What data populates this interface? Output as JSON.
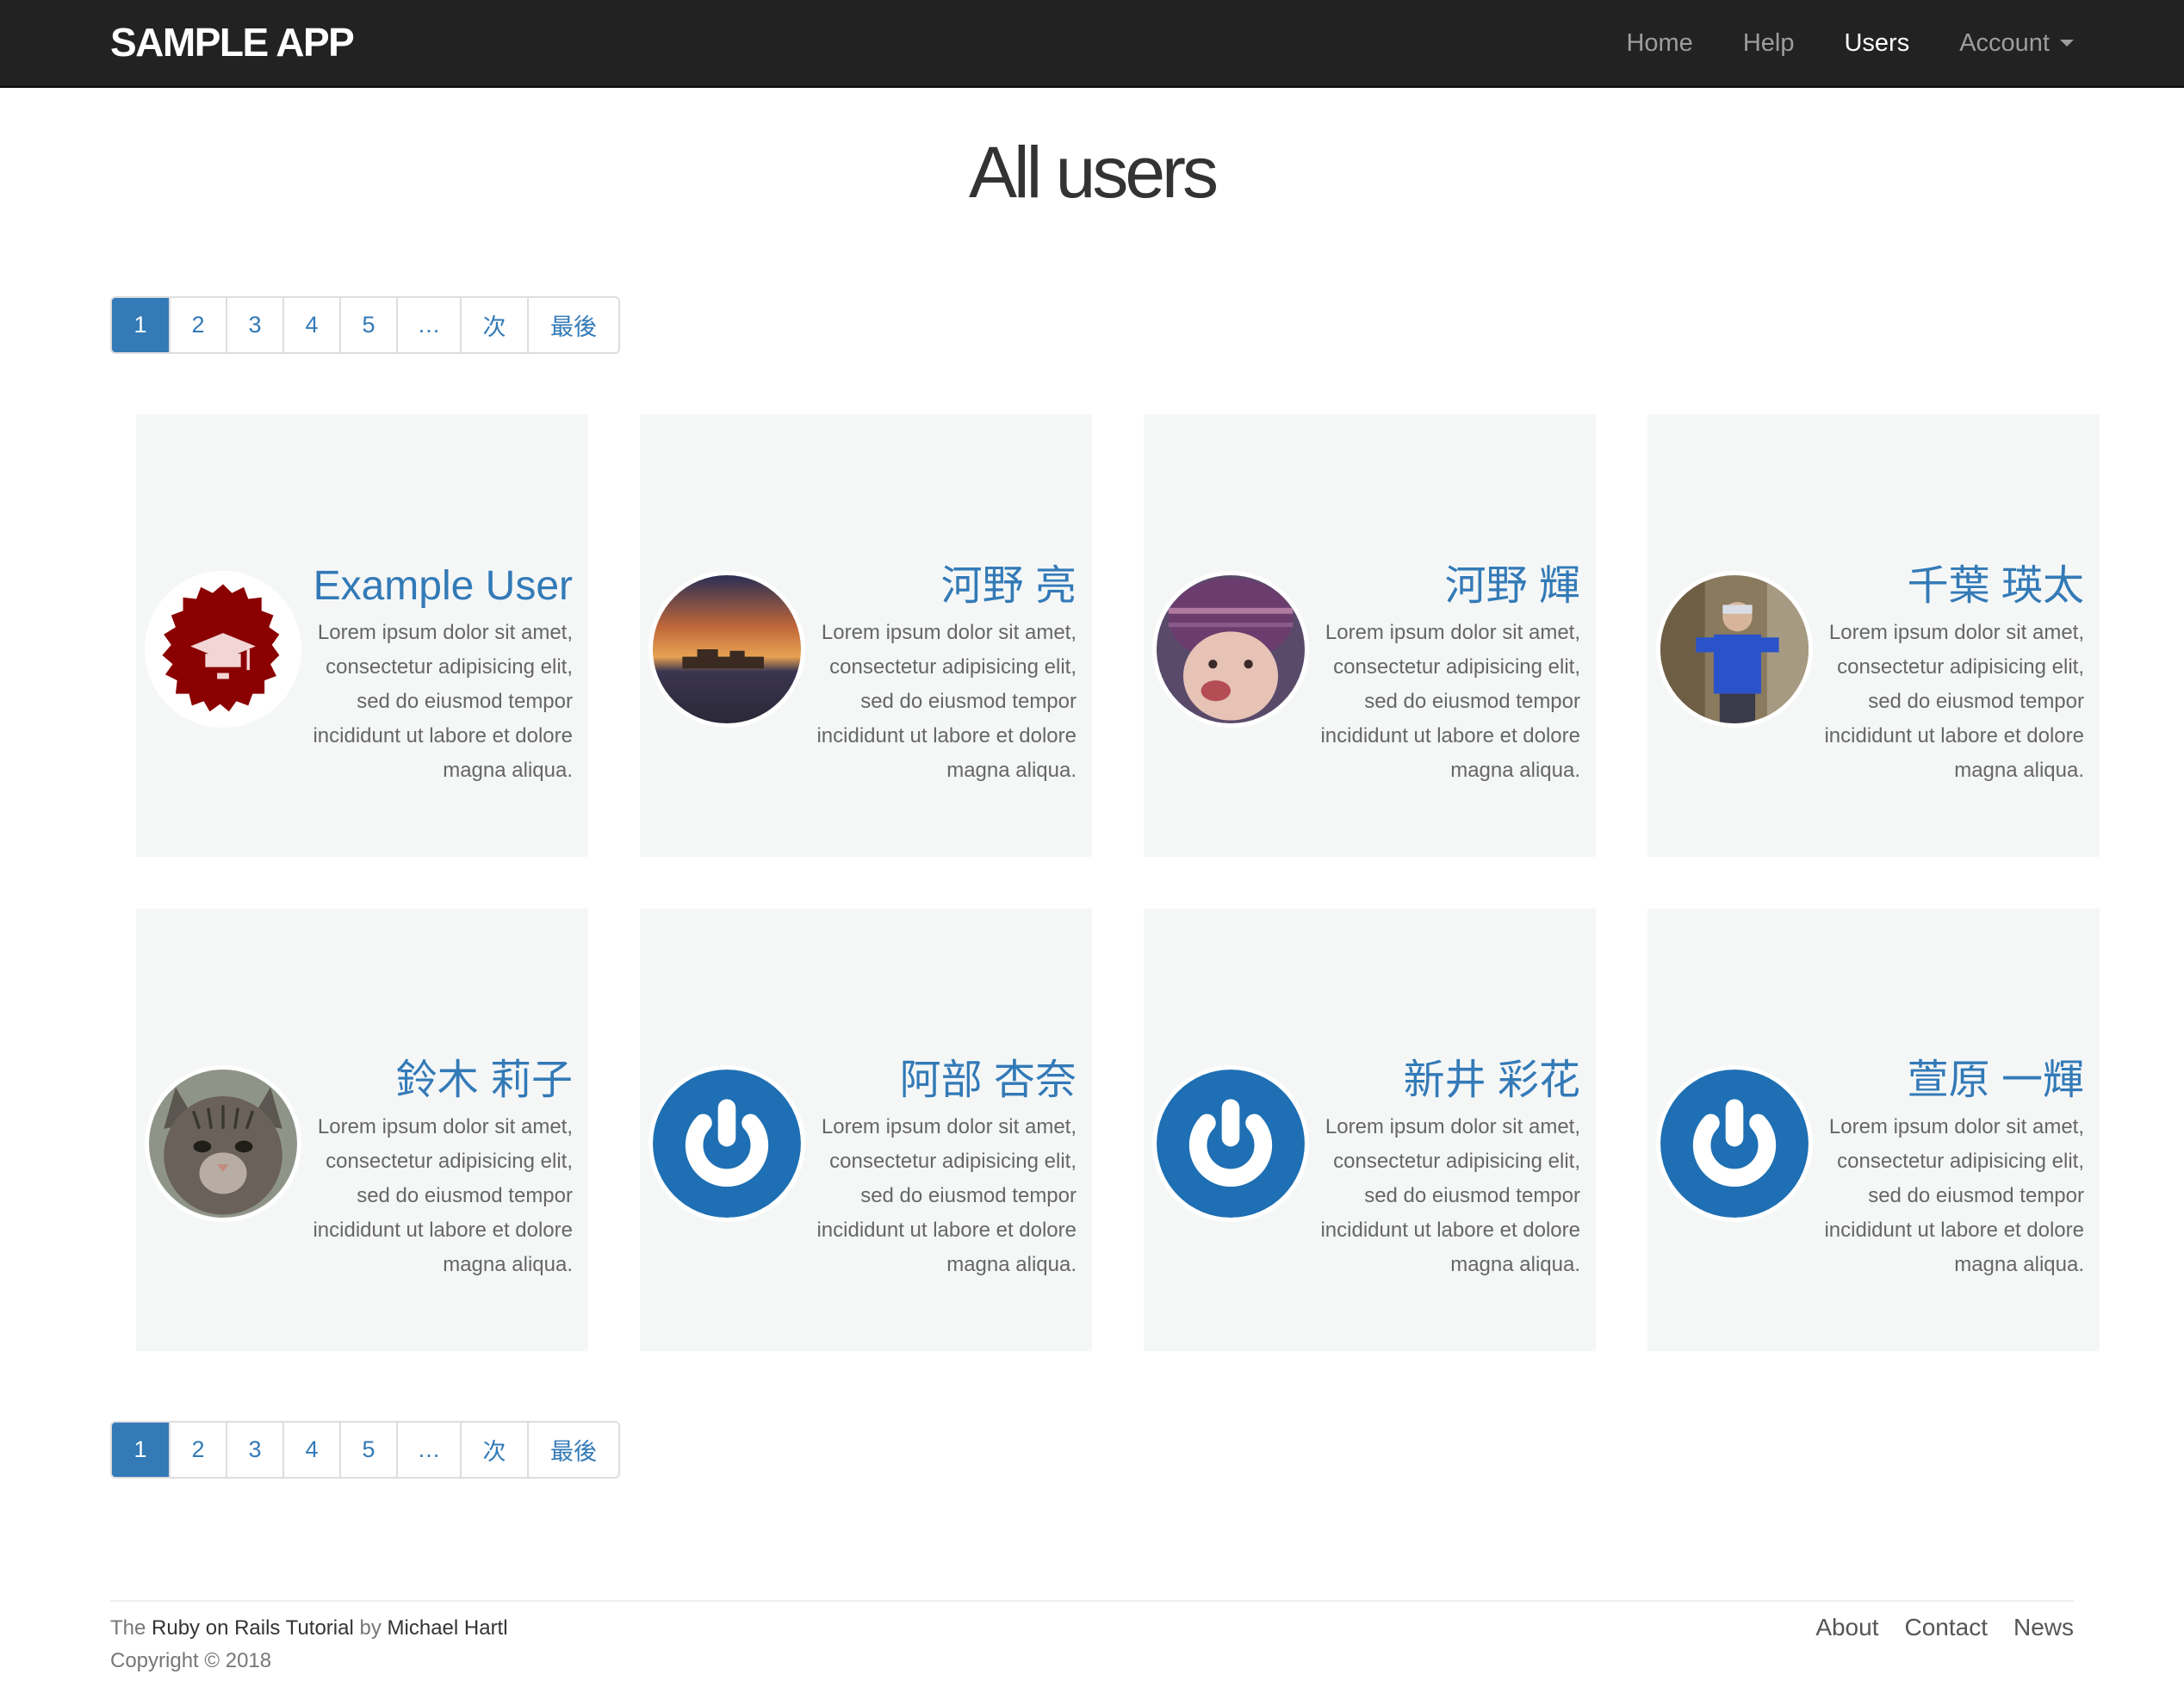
{
  "navbar": {
    "brand": "SAMPLE APP",
    "links": [
      {
        "label": "Home",
        "active": false
      },
      {
        "label": "Help",
        "active": false
      },
      {
        "label": "Users",
        "active": true
      }
    ],
    "account_label": "Account"
  },
  "page_title": "All users",
  "pagination": {
    "items": [
      "1",
      "2",
      "3",
      "4",
      "5",
      "…",
      "次",
      "最後"
    ],
    "current": "1"
  },
  "users": [
    {
      "name": "Example User",
      "avatar": "graduation-cap-badge"
    },
    {
      "name": "河野 亮",
      "avatar": "sunset-photo"
    },
    {
      "name": "河野 輝",
      "avatar": "child-photo"
    },
    {
      "name": "千葉 瑛太",
      "avatar": "person-photo"
    },
    {
      "name": "鈴木 莉子",
      "avatar": "cat-photo"
    },
    {
      "name": "阿部 杏奈",
      "avatar": "gravatar-default"
    },
    {
      "name": "新井 彩花",
      "avatar": "gravatar-default"
    },
    {
      "name": "萱原 一輝",
      "avatar": "gravatar-default"
    }
  ],
  "bio_text": "Lorem ipsum dolor sit amet, consectetur adipisicing elit, sed do eiusmod tempor incididunt ut labore et dolore magna aliqua.",
  "footer": {
    "credit_prefix": "The",
    "credit_link": "Ruby on Rails Tutorial",
    "credit_by": "by",
    "credit_author": "Michael Hartl",
    "copyright": "Copyright © 2018",
    "links": [
      "About",
      "Contact",
      "News"
    ]
  },
  "colors": {
    "link": "#337ab7",
    "navbar": "#222222",
    "card": "#f5f7f7",
    "badge": "#8b0000",
    "gravatar_blue": "#1e6fb3"
  }
}
